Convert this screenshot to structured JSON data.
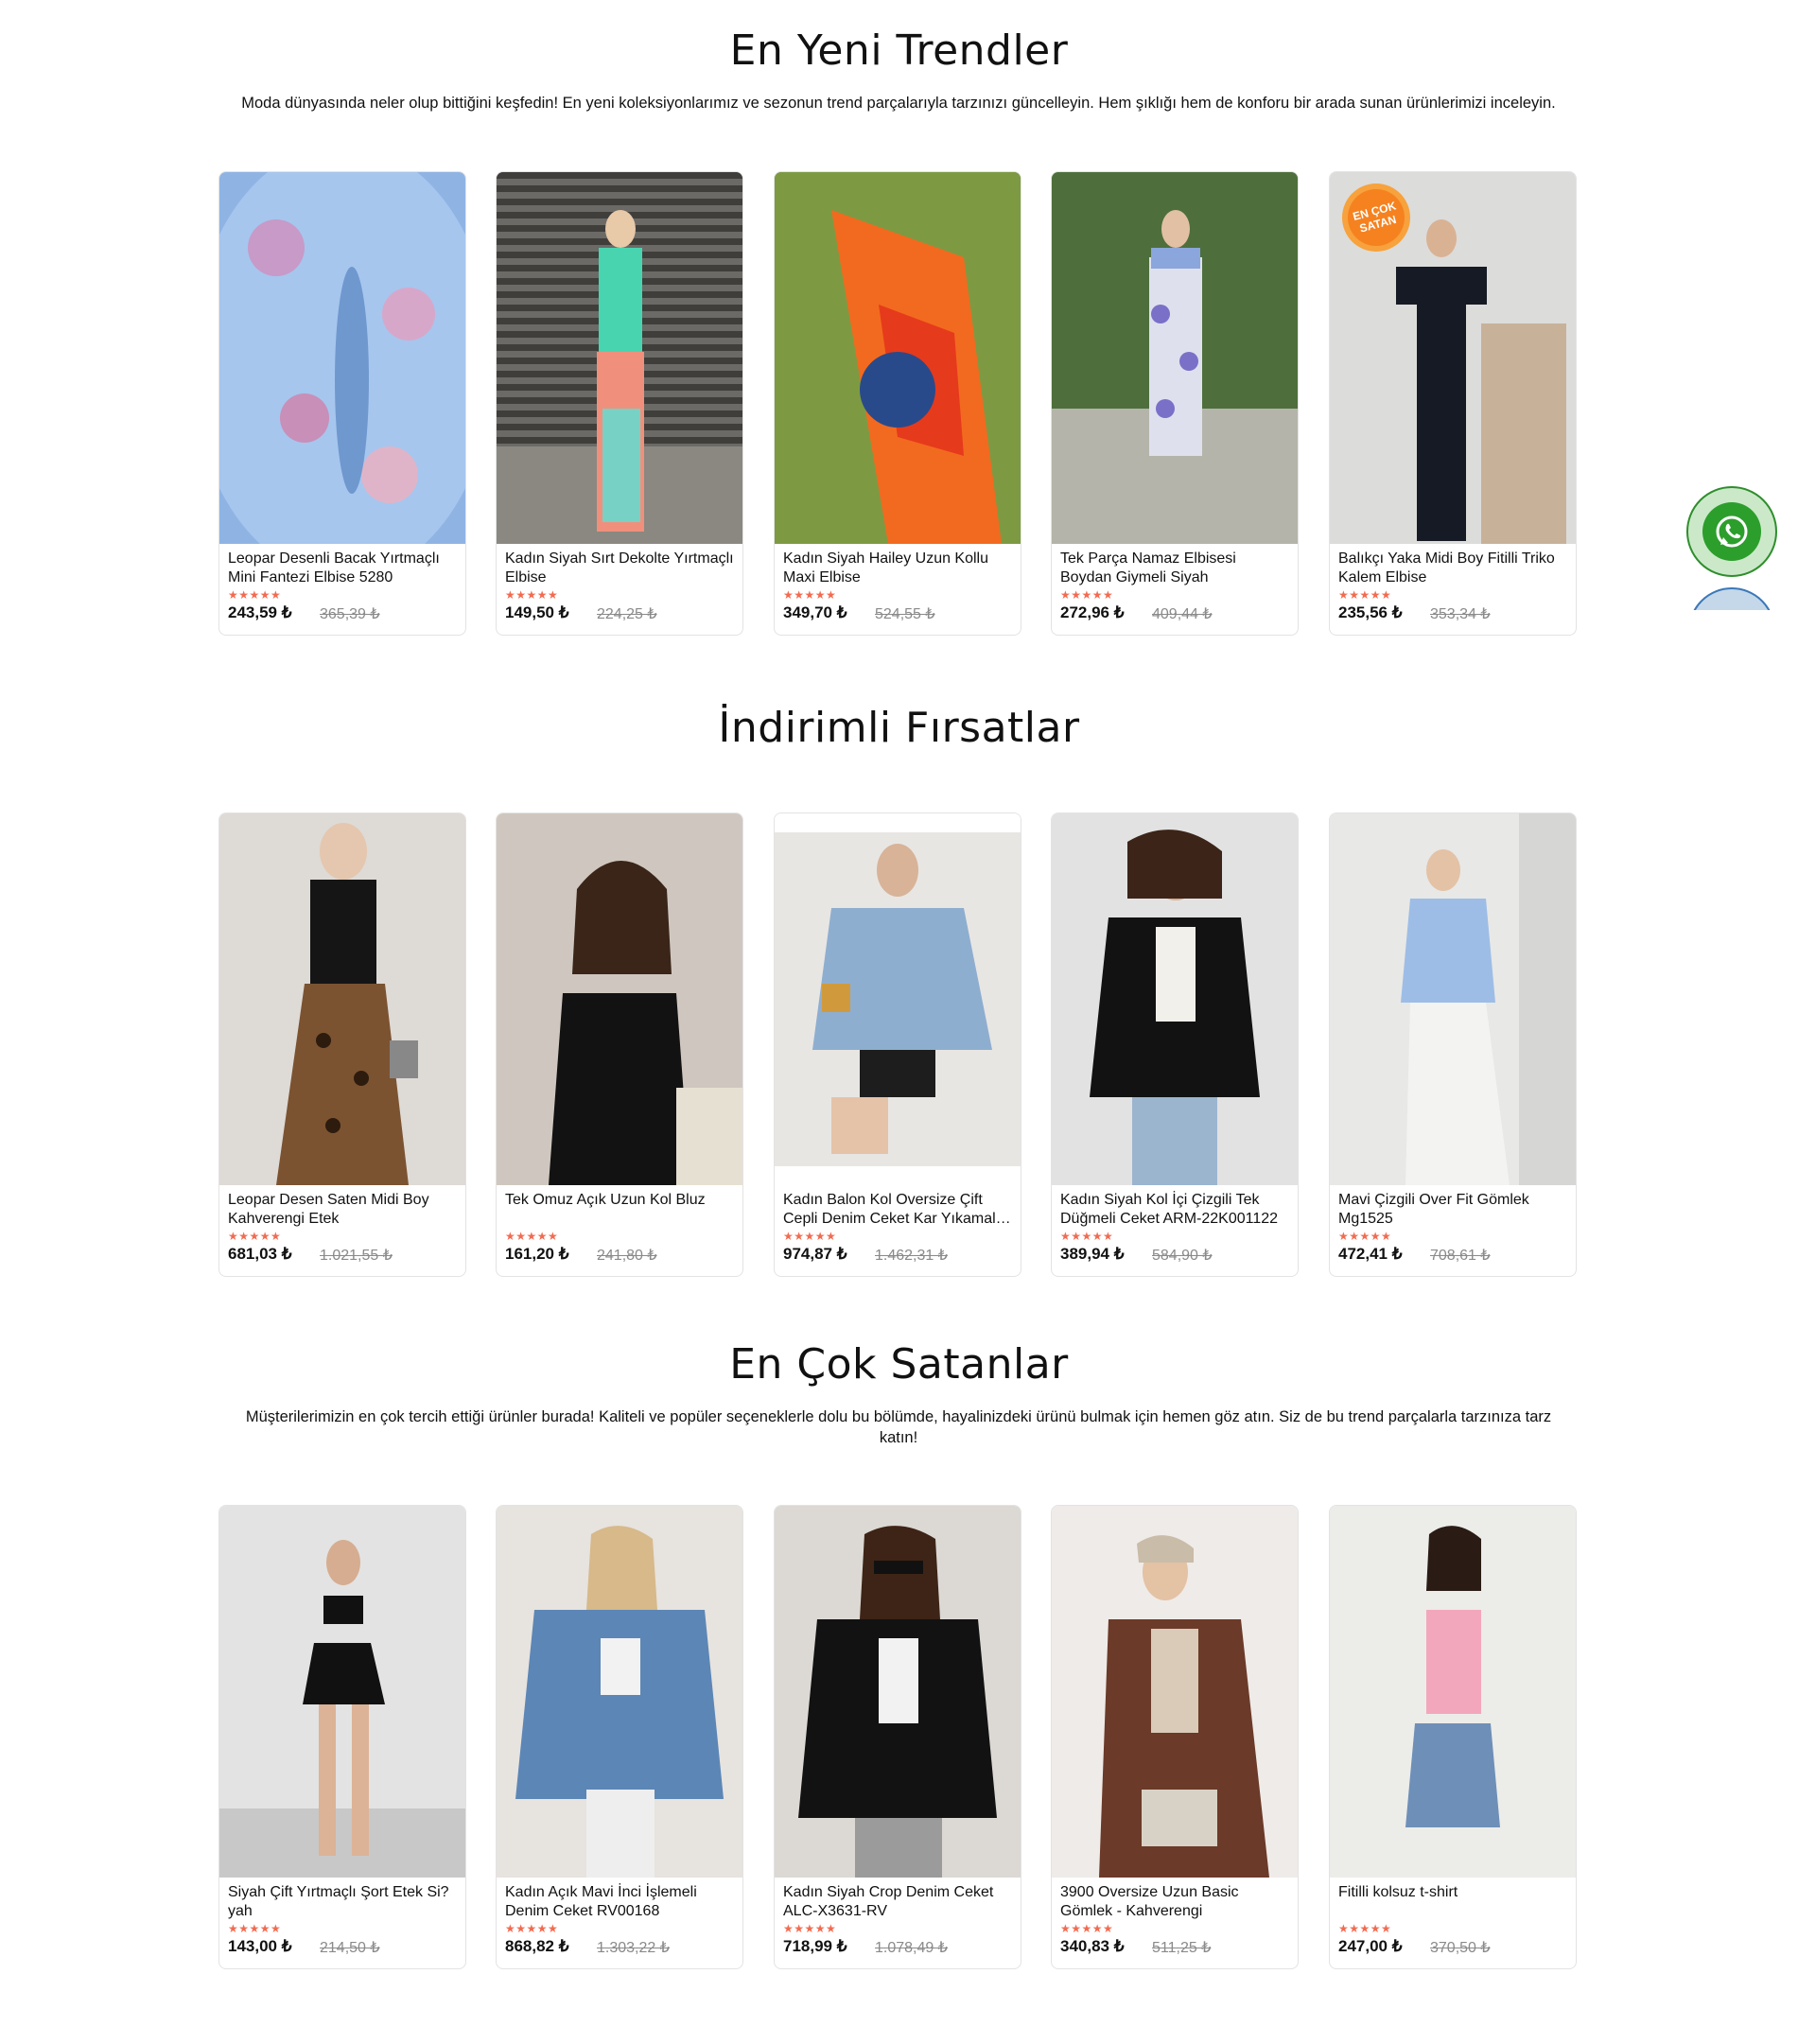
{
  "sections": [
    {
      "title": "En Yeni Trendler",
      "description": "Moda dünyasında neler olup bittiğini keşfedin! En yeni koleksiyonlarımız ve sezonun trend parçalarıyla tarzınızı güncelleyin. Hem şıklığı hem de konforu bir arada sunan ürünlerimizi inceleyin.",
      "products": [
        {
          "name": "Leopar Desenli Bacak Yırtmaçlı Mini Fantezi Elbise 5280",
          "stars": "★★★★★",
          "price": "243,59 ₺",
          "old_price": "365,39 ₺"
        },
        {
          "name": "Kadın Siyah Sırt Dekolte Yırtmaçlı Elbise",
          "stars": "★★★★★",
          "price": "149,50 ₺",
          "old_price": "224,25 ₺"
        },
        {
          "name": "Kadın Siyah Hailey Uzun Kollu Maxi Elbise",
          "stars": "★★★★★",
          "price": "349,70 ₺",
          "old_price": "524,55 ₺"
        },
        {
          "name": "Tek Parça Namaz Elbisesi Boydan Giymeli Siyah",
          "stars": "★★★★★",
          "price": "272,96 ₺",
          "old_price": "409,44 ₺"
        },
        {
          "name": "Balıkçı Yaka Midi Boy Fitilli Triko Kalem Elbise",
          "stars": "★★★★★",
          "price": "235,56 ₺",
          "old_price": "353,34 ₺",
          "badge": "EN ÇOK SATAN"
        }
      ]
    },
    {
      "title": "İndirimli Fırsatlar",
      "description": "",
      "products": [
        {
          "name": "Leopar Desen Saten Midi Boy Kahverengi Etek",
          "stars": "★★★★★",
          "price": "681,03 ₺",
          "old_price": "1.021,55 ₺"
        },
        {
          "name": "Tek Omuz Açık Uzun Kol Bluz",
          "stars": "★★★★★",
          "price": "161,20 ₺",
          "old_price": "241,80 ₺"
        },
        {
          "name": "Kadın Balon Kol Oversize Çift Cepli Denim Ceket Kar Yıkamal…",
          "stars": "★★★★★",
          "price": "974,87 ₺",
          "old_price": "1.462,31 ₺"
        },
        {
          "name": "Kadın Siyah Kol İçi Çizgili Tek Düğmeli Ceket ARM-22K001122",
          "stars": "★★★★★",
          "price": "389,94 ₺",
          "old_price": "584,90 ₺"
        },
        {
          "name": "Mavi Çizgili Over Fit Gömlek Mg1525",
          "stars": "★★★★★",
          "price": "472,41 ₺",
          "old_price": "708,61 ₺"
        }
      ]
    },
    {
      "title": "En Çok Satanlar",
      "description": "Müşterilerimizin en çok tercih ettiği ürünler burada! Kaliteli ve popüler seçeneklerle dolu bu bölümde, hayalinizdeki ürünü bulmak için hemen göz atın. Siz de bu trend parçalarla tarzınıza tarz katın!",
      "products": [
        {
          "name": "Siyah Çift Yırtmaçlı Şort Etek Si?yah",
          "stars": "★★★★★",
          "price": "143,00 ₺",
          "old_price": "214,50 ₺"
        },
        {
          "name": "Kadın Açık Mavi İnci İşlemeli Denim Ceket RV00168",
          "stars": "★★★★★",
          "price": "868,82 ₺",
          "old_price": "1.303,22 ₺"
        },
        {
          "name": "Kadın Siyah Crop Denim Ceket ALC-X3631-RV",
          "stars": "★★★★★",
          "price": "718,99 ₺",
          "old_price": "1.078,49 ₺"
        },
        {
          "name": "3900 Oversize Uzun Basic Gömlek - Kahverengi",
          "stars": "★★★★★",
          "price": "340,83 ₺",
          "old_price": "511,25 ₺"
        },
        {
          "name": "Fitilli kolsuz t-shirt",
          "stars": "★★★★★",
          "price": "247,00 ₺",
          "old_price": "370,50 ₺"
        }
      ]
    }
  ],
  "floating": {
    "whatsapp_icon": "whatsapp-icon",
    "second_icon": "phone-icon"
  },
  "colors": {
    "star": "#f26b50",
    "whatsapp": "#2c9e2c",
    "badge": "#f5821f"
  }
}
